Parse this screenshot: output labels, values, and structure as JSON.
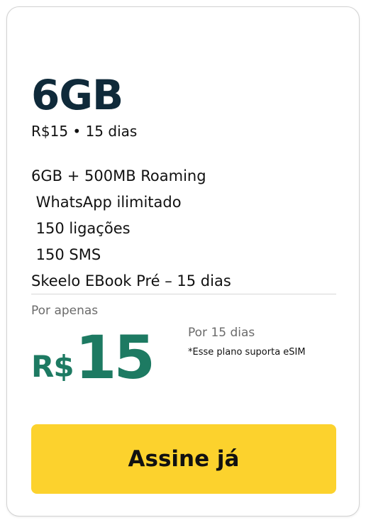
{
  "plan": {
    "title": "6GB",
    "subtitle": "R$15 • 15 dias",
    "features": [
      "6GB + 500MB Roaming",
      " WhatsApp ilimitado",
      " 150 ligações",
      " 150 SMS",
      "Skeelo EBook Pré – 15 dias"
    ]
  },
  "pricing": {
    "prefix": "Por apenas",
    "currency": "R$",
    "amount": "15",
    "period": "Por 15 dias",
    "note": "*Esse plano suporta eSIM"
  },
  "cta": {
    "label": "Assine já"
  },
  "colors": {
    "title": "#0f2a3a",
    "price": "#1d7a62",
    "cta_background": "#fcd22d"
  }
}
